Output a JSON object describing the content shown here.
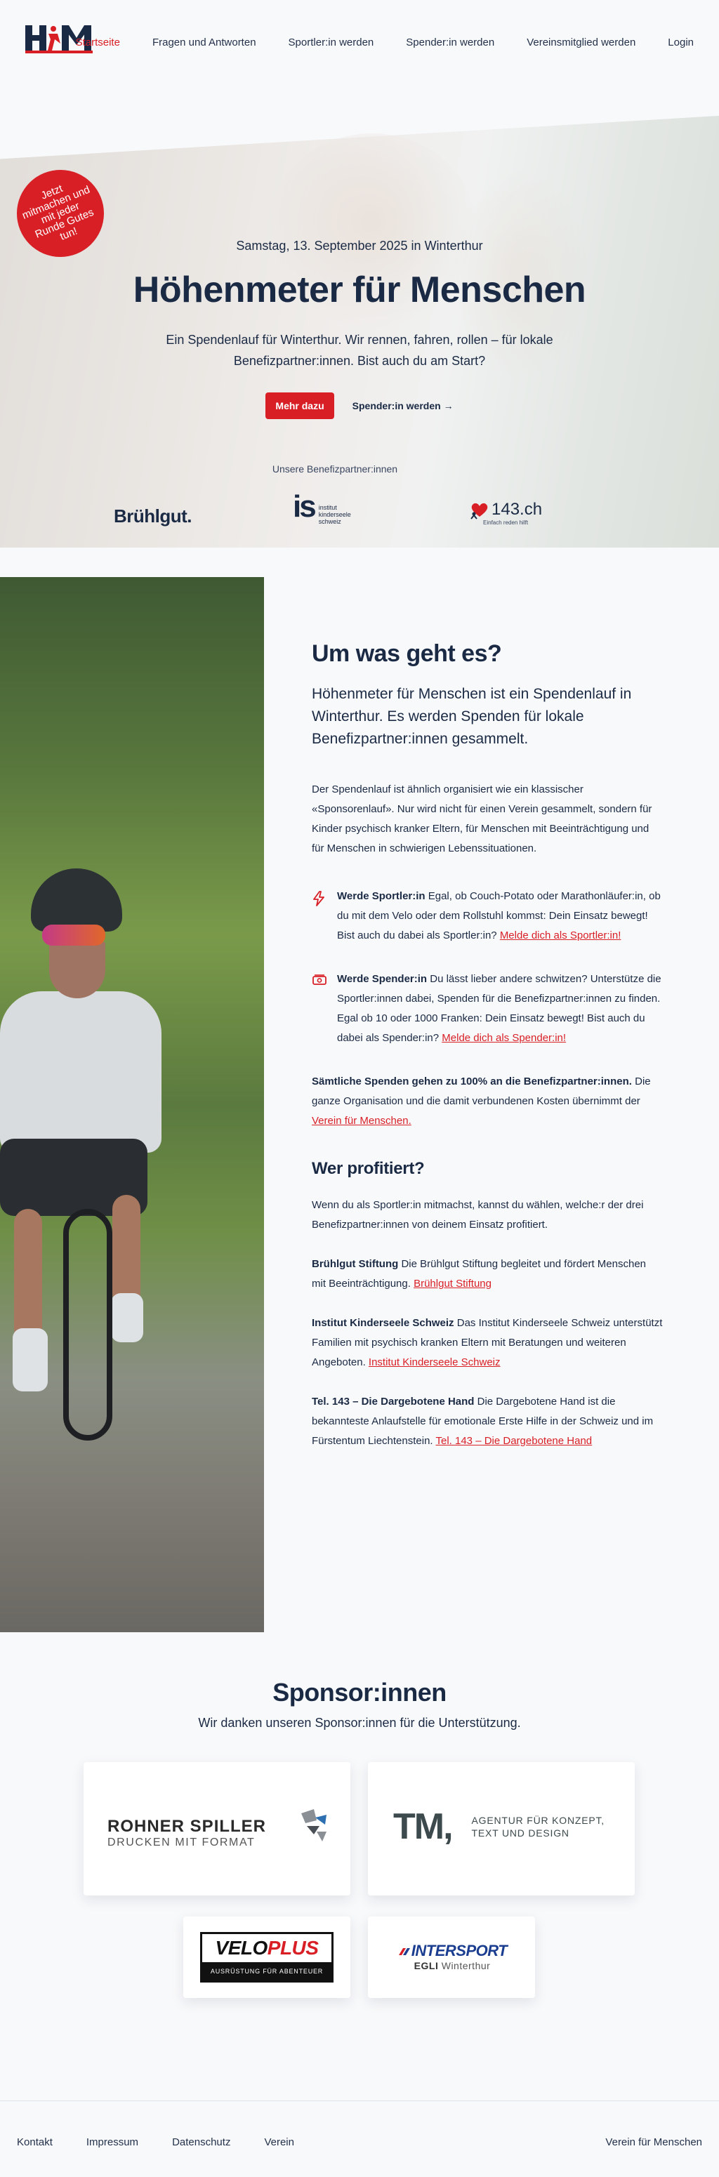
{
  "header": {
    "logo_alt": "HfM",
    "nav": [
      {
        "label": "Startseite"
      },
      {
        "label": "Fragen und Antworten"
      },
      {
        "label": "Sportler:in werden"
      },
      {
        "label": "Spender:in werden"
      },
      {
        "label": "Vereinsmitglied werden"
      },
      {
        "label": "Login"
      }
    ]
  },
  "hero": {
    "badge": "Jetzt mitmachen und mit jeder Runde Gutes tun!",
    "date": "Samstag, 13. September 2025 in Winterthur",
    "title": "Höhenmeter für Menschen",
    "lead": "Ein Spendenlauf für Winterthur. Wir rennen, fahren, rollen – für lokale Benefizpartner:innen. Bist auch du am Start?",
    "cta_primary": "Mehr dazu",
    "cta_secondary": "Spender:in werden →",
    "partners_label": "Unsere Benefizpartner:innen",
    "partners": {
      "bruehlgut": "Brühlgut.",
      "is_mark": "is",
      "is_text": [
        "institut",
        "kinderseele",
        "schweiz"
      ],
      "tel143": "143.ch",
      "tel143_sub": "Einfach reden hilft"
    }
  },
  "about": {
    "title": "Um was geht es?",
    "lead": "Höhenmeter für Menschen ist ein Spendenlauf in Winterthur. Es werden Spenden für lokale Benefizpartner:innen gesammelt.",
    "intro": "Der Spendenlauf ist ähnlich organisiert wie ein klassischer «Sponsorenlauf». Nur wird nicht für einen Verein gesammelt, sondern für Kinder psychisch kranker Eltern, für Menschen mit Beeinträchtigung und für Menschen in schwierigen Lebenssituationen.",
    "athlete": {
      "heading": "Werde Sportler:in",
      "text": " Egal, ob Couch-Potato oder Marathonläufer:in, ob du mit dem Velo oder dem Rollstuhl kommst: Dein Einsatz bewegt! Bist auch du dabei als Sportler:in? ",
      "link": "Melde dich als Sportler:in!"
    },
    "donor": {
      "heading": "Werde Spender:in",
      "text": " Du lässt lieber andere schwitzen? Unterstütze die Sportler:innen dabei, Spenden für die Benefizpartner:innen zu finden. Egal ob 10 oder 1000 Franken: Dein Einsatz bewegt! Bist auch du dabei als Spender:in? ",
      "link": "Melde dich als Spender:in!"
    },
    "all_donations_bold": "Sämtliche Spenden gehen zu 100% an die Benefizpartner:innen.",
    "all_donations_text": " Die ganze Organisation und die damit verbundenen Kosten übernimmt der ",
    "all_donations_link": "Verein für Menschen."
  },
  "beneficiaries": {
    "title": "Wer profitiert?",
    "intro": "Wenn du als Sportler:in mitmachst, kannst du wählen, welche:r der drei Benefizpartner:innen von deinem Einsatz profitiert.",
    "items": [
      {
        "name": "Brühlgut Stiftung",
        "text": " Die Brühlgut Stiftung begleitet und fördert Menschen mit Beeinträchtigung. ",
        "link": "Brühlgut Stiftung"
      },
      {
        "name": "Institut Kinderseele Schweiz",
        "text": " Das Institut Kinderseele Schweiz unterstützt Familien mit psychisch kranken Eltern mit Beratungen und weiteren Angeboten. ",
        "link": "Institut Kinderseele Schweiz"
      },
      {
        "name": "Tel. 143 – Die Dargebotene Hand",
        "text": " Die Dargebotene Hand ist die bekannteste Anlaufstelle für emotionale Erste Hilfe in der Schweiz und im Fürstentum Liechtenstein. ",
        "link": "Tel. 143 – Die Dargebotene Hand"
      }
    ]
  },
  "sponsors": {
    "title": "Sponsor:innen",
    "subtitle": "Wir danken unseren Sponsor:innen für die Unterstützung.",
    "rohner": {
      "name": "ROHNER SPILLER",
      "sub": "DRUCKEN MIT FORMAT"
    },
    "tm": {
      "mark": "TM,",
      "text_1": "AGENTUR FÜR KONZEPT,",
      "text_2": "TEXT UND DESIGN"
    },
    "veloplus": {
      "name_a": "VELO",
      "name_b": "PLUS",
      "sub": "AUSRÜSTUNG FÜR ABENTEUER"
    },
    "intersport": {
      "name": "INTERSPORT",
      "sub_bold": "EGLI",
      "sub": " Winterthur"
    }
  },
  "footer": {
    "links": [
      {
        "label": "Kontakt"
      },
      {
        "label": "Impressum"
      },
      {
        "label": "Datenschutz"
      },
      {
        "label": "Verein"
      }
    ],
    "right": "Verein für Menschen"
  },
  "colors": {
    "accent": "#d81f26",
    "ink": "#1b2a44",
    "background": "#f8f9fb"
  }
}
